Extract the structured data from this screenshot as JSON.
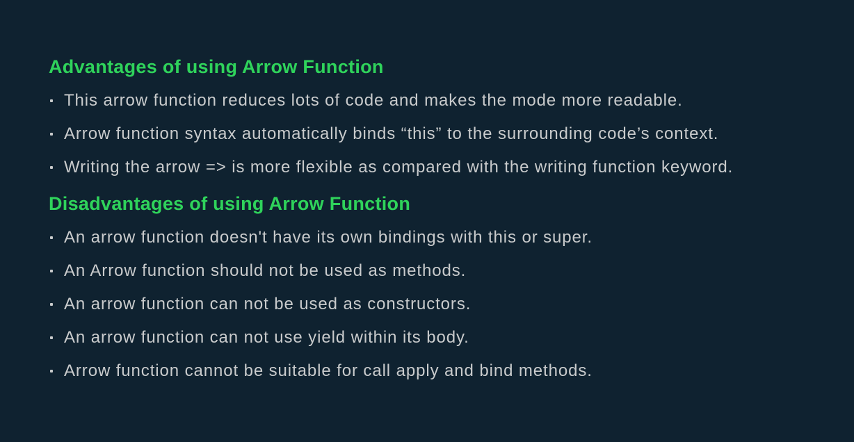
{
  "advantages": {
    "title": "Advantages of using Arrow Function",
    "items": [
      "This arrow function reduces lots of code and makes the mode more readable.",
      "Arrow function syntax automatically binds “this” to the surrounding code’s context.",
      "Writing the arrow => is more flexible as compared with the writing function keyword."
    ]
  },
  "disadvantages": {
    "title": "Disadvantages of using Arrow Function",
    "items": [
      "An arrow function doesn't have its own bindings with this or super.",
      "An Arrow function should not be used as methods.",
      "An arrow function can not be used as constructors.",
      "An arrow function can not use yield within its body.",
      "Arrow function cannot be suitable for call apply and bind methods."
    ]
  },
  "colors": {
    "background": "#0f2230",
    "heading": "#2fd35b",
    "text": "#c9cbcc"
  }
}
